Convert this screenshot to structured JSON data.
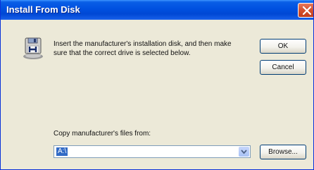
{
  "window": {
    "title": "Install From Disk"
  },
  "dialog": {
    "message": "Insert the manufacturer's installation disk, and then make sure that the correct drive is selected below.",
    "ok_label": "OK",
    "cancel_label": "Cancel",
    "copy_label": "Copy manufacturer's files from:",
    "path_value": "A:\\",
    "browse_label": "Browse..."
  },
  "icons": {
    "titlebar_close": "close-icon",
    "dialog": "disk-drive-icon",
    "combo_arrow": "chevron-down-icon"
  },
  "colors": {
    "titlebar": "#0050e0",
    "dialog_bg": "#ece9d8",
    "close_button": "#d4502e",
    "selection": "#316ac5"
  }
}
